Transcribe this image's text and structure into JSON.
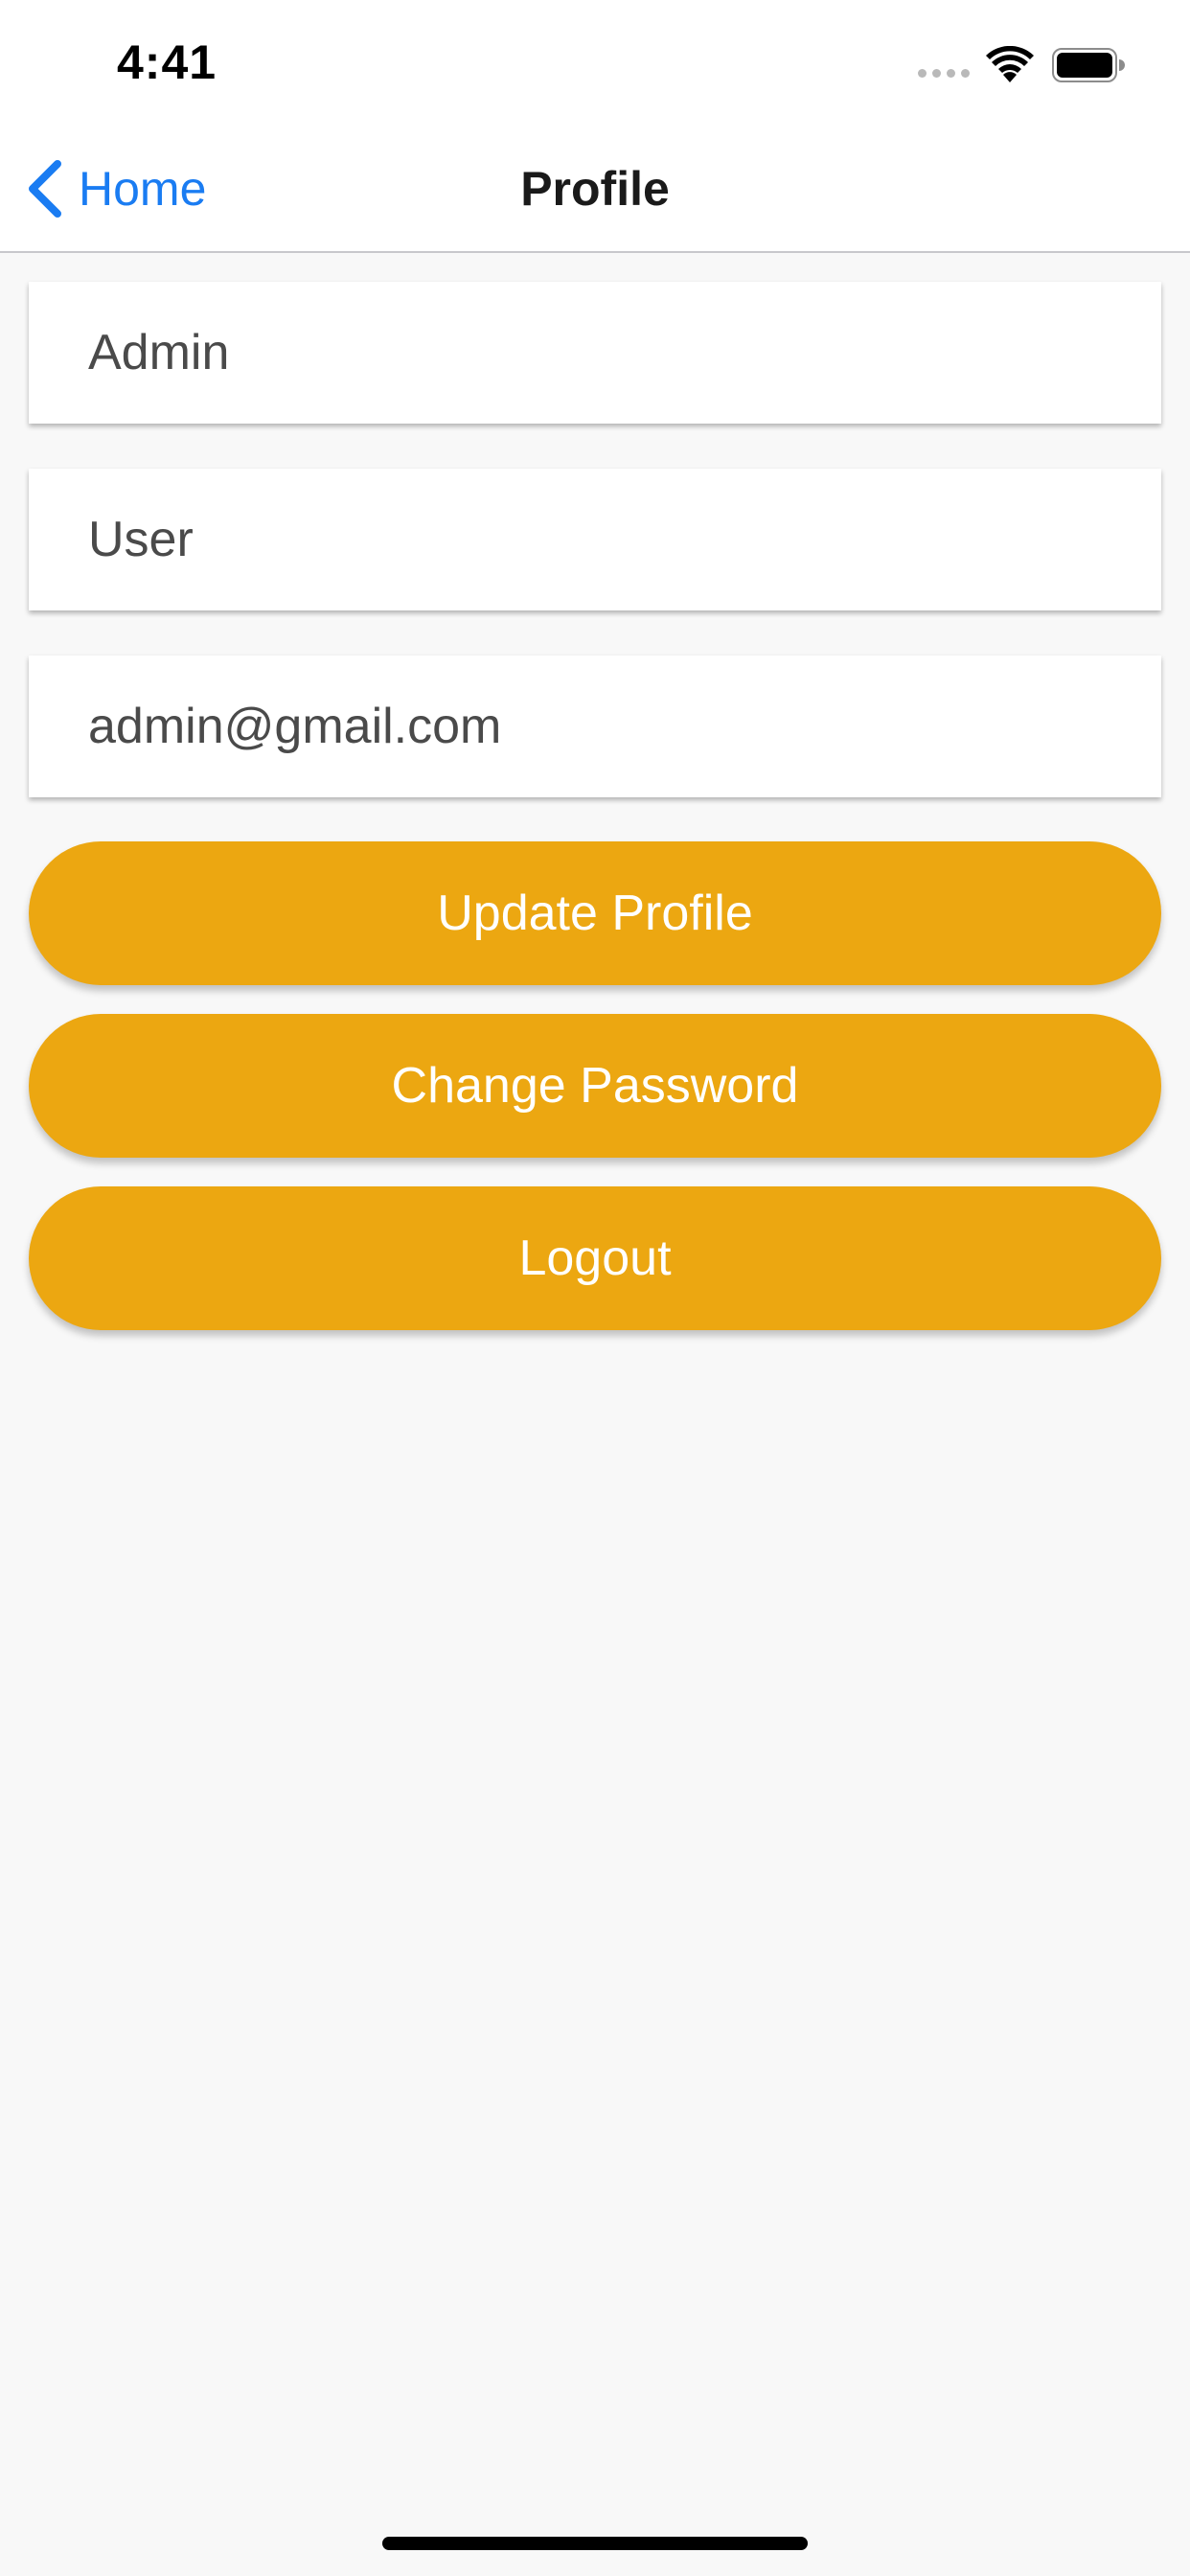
{
  "status_bar": {
    "time": "4:41",
    "icons": [
      "signal-dots-icon",
      "wifi-icon",
      "battery-icon"
    ]
  },
  "nav": {
    "back_label": "Home",
    "title": "Profile",
    "accent_color": "#1a7cf2"
  },
  "form": {
    "first_name": "Admin",
    "last_name": "User",
    "email": "admin@gmail.com"
  },
  "buttons": {
    "update_profile": "Update Profile",
    "change_password": "Change Password",
    "logout": "Logout",
    "color": "#eca711"
  }
}
